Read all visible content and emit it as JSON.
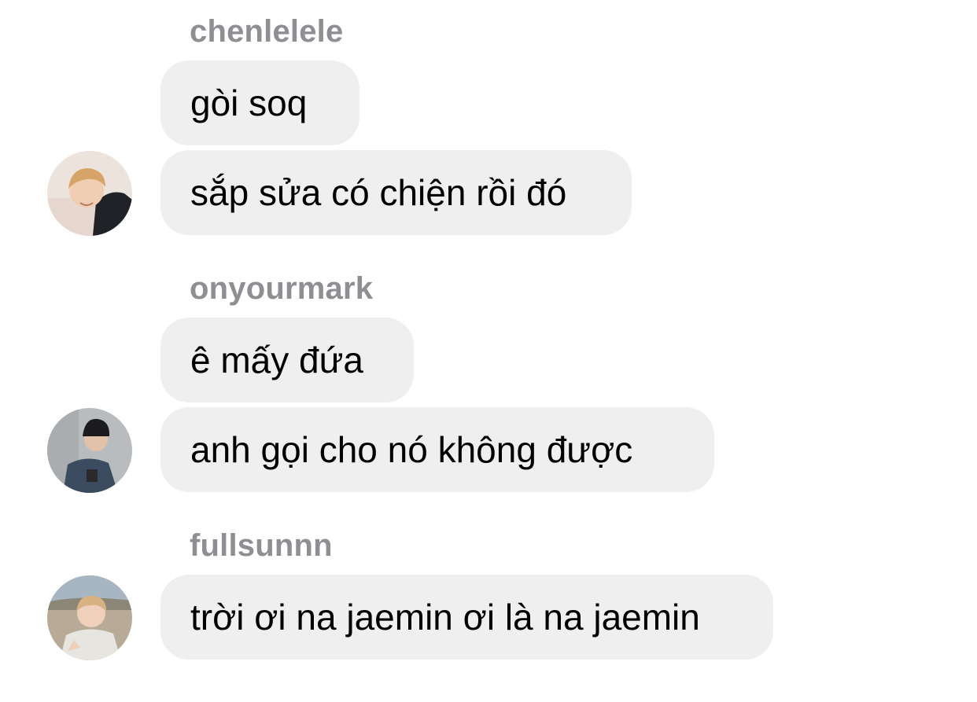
{
  "conversation": {
    "groups": [
      {
        "sender": "chenlelele",
        "avatar_icon": "user-avatar-photo",
        "messages": [
          "gòi soq",
          "sắp sửa có chiện rồi đó"
        ]
      },
      {
        "sender": "onyourmark",
        "avatar_icon": "user-avatar-photo",
        "messages": [
          "ê mấy đứa",
          "anh gọi cho nó không được"
        ]
      },
      {
        "sender": "fullsunnn",
        "avatar_icon": "user-avatar-photo",
        "messages": [
          "trời ơi na jaemin ơi là na jaemin"
        ]
      }
    ]
  },
  "colors": {
    "bubble_background": "#efefef",
    "sender_name": "#8e8e93",
    "message_text": "#000000",
    "page_background": "#ffffff"
  }
}
